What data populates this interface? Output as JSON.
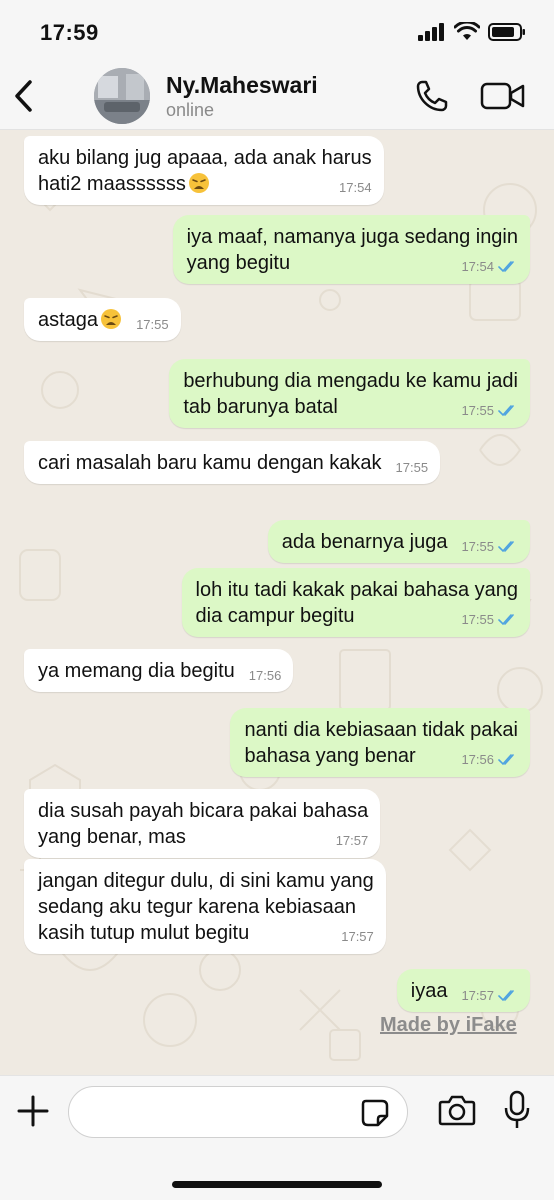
{
  "status_bar": {
    "time": "17:59"
  },
  "header": {
    "contact_name": "Ny.Maheswari",
    "contact_status": "online",
    "icons": {
      "back": "chevron-left-icon",
      "call": "phone-icon",
      "video": "video-camera-icon"
    }
  },
  "colors": {
    "incoming_bubble": "#ffffff",
    "outgoing_bubble": "#dcf8c6",
    "read_ticks": "#4fa3e0",
    "chat_background": "#efeae2"
  },
  "messages": [
    {
      "direction": "in",
      "text": "aku bilang jug apaaa, ada anak harus\nhati2 maassssss",
      "emoji": "weary-face",
      "time": "17:54"
    },
    {
      "direction": "out",
      "text": "iya maaf, namanya juga sedang ingin\nyang begitu",
      "time": "17:54",
      "read": true
    },
    {
      "direction": "in",
      "text": "astaga",
      "emoji": "weary-face",
      "time": "17:55"
    },
    {
      "direction": "out",
      "text": "berhubung dia mengadu ke kamu jadi\ntab barunya batal",
      "time": "17:55",
      "read": true
    },
    {
      "direction": "in",
      "text": "cari masalah baru kamu dengan kakak",
      "time": "17:55"
    },
    {
      "direction": "out",
      "text": "ada benarnya juga",
      "time": "17:55",
      "read": true
    },
    {
      "direction": "out",
      "text": "loh itu tadi kakak pakai bahasa yang\ndia campur begitu",
      "time": "17:55",
      "read": true
    },
    {
      "direction": "in",
      "text": "ya memang dia begitu",
      "time": "17:56"
    },
    {
      "direction": "out",
      "text": "nanti dia kebiasaan tidak pakai\nbahasa yang benar",
      "time": "17:56",
      "read": true
    },
    {
      "direction": "in",
      "text": "dia susah payah bicara pakai bahasa\nyang benar, mas",
      "time": "17:57"
    },
    {
      "direction": "in",
      "text": "jangan ditegur dulu, di sini kamu yang\nsedang aku tegur karena kebiasaan\nkasih tutup mulut begitu",
      "time": "17:57"
    },
    {
      "direction": "out",
      "text": "iyaa",
      "time": "17:57",
      "read": true
    }
  ],
  "watermark": "Made by iFake",
  "input_bar": {
    "message_value": "",
    "icons": {
      "attach": "plus-icon",
      "sticker": "sticker-icon",
      "camera": "camera-icon",
      "mic": "microphone-icon"
    }
  }
}
